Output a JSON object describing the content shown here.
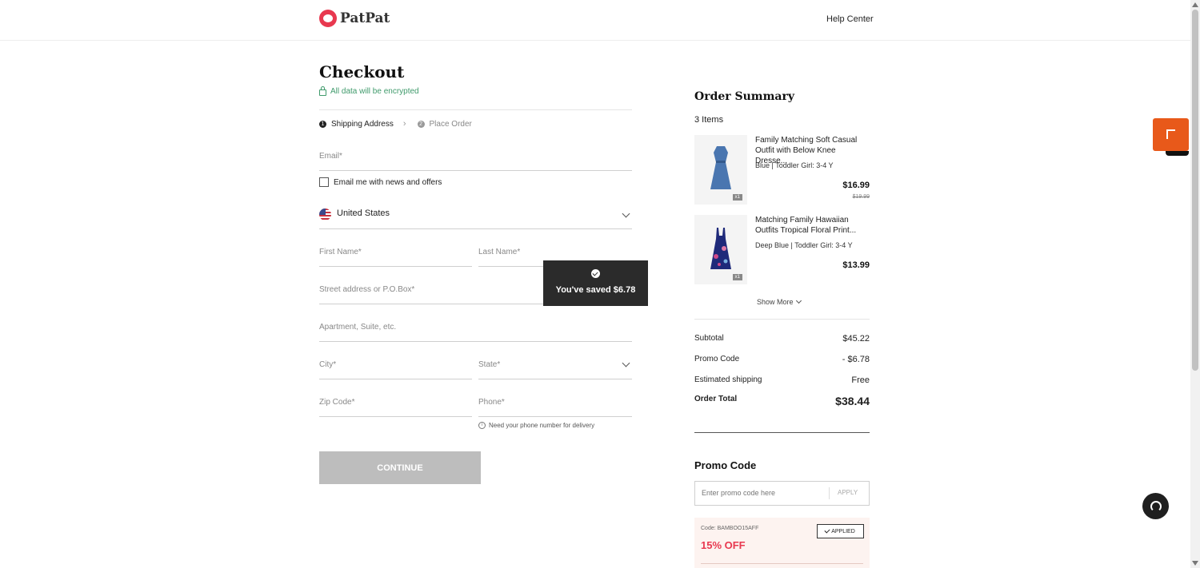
{
  "header": {
    "brand": "PatPat",
    "help_center": "Help Center"
  },
  "checkout": {
    "title": "Checkout",
    "encrypted_note": "All data will be encrypted",
    "steps": [
      {
        "num": "1",
        "label": "Shipping Address",
        "active": true
      },
      {
        "num": "2",
        "label": "Place Order",
        "active": false
      }
    ],
    "email_label": "Email*",
    "newsletter_label": "Email me with news and offers",
    "country": "United States",
    "first_name_label": "First Name*",
    "last_name_label": "Last Name*",
    "street_label": "Street address or P.O.Box*",
    "apartment_label": "Apartment, Suite, etc.",
    "city_label": "City*",
    "state_label": "State*",
    "zip_label": "Zip Code*",
    "phone_label": "Phone*",
    "phone_hint": "Need your phone number for delivery",
    "continue_label": "CONTINUE"
  },
  "toast": {
    "text": "You've saved $6.78"
  },
  "summary": {
    "title": "Order Summary",
    "items_count": "3 Items",
    "products": [
      {
        "title": "Family Matching Soft Casual Outfit with Below Knee Dresse...",
        "variant": "Blue | Toddler Girl: 3-4 Y",
        "price": "$16.99",
        "original_price": "$19.99",
        "qty": "x1",
        "color": "#4a76b0"
      },
      {
        "title": "Matching Family Hawaiian Outfits Tropical Floral Print...",
        "variant": "Deep Blue | Toddler Girl: 3-4 Y",
        "price": "$13.99",
        "original_price": "",
        "qty": "x1",
        "color": "#1f2a7a"
      }
    ],
    "show_more": "Show More",
    "subtotal_label": "Subtotal",
    "subtotal_value": "$45.22",
    "promo_label": "Promo Code",
    "promo_value": "- $6.78",
    "shipping_label": "Estimated shipping",
    "shipping_value": "Free",
    "total_label": "Order Total",
    "total_value": "$38.44"
  },
  "promo": {
    "title": "Promo Code",
    "placeholder": "Enter promo code here",
    "apply_label": "APPLY",
    "coupon_code": "Code: BAMBOO15AFF",
    "applied_label": "APPLIED",
    "coupon_off": "15% OFF"
  },
  "colors": {
    "brand": "#e8384f",
    "secure_green": "#3f9a6b",
    "continue_disabled": "#bdbdbd",
    "toast_bg": "#2b2b2b",
    "float_orange": "#e8591a"
  }
}
